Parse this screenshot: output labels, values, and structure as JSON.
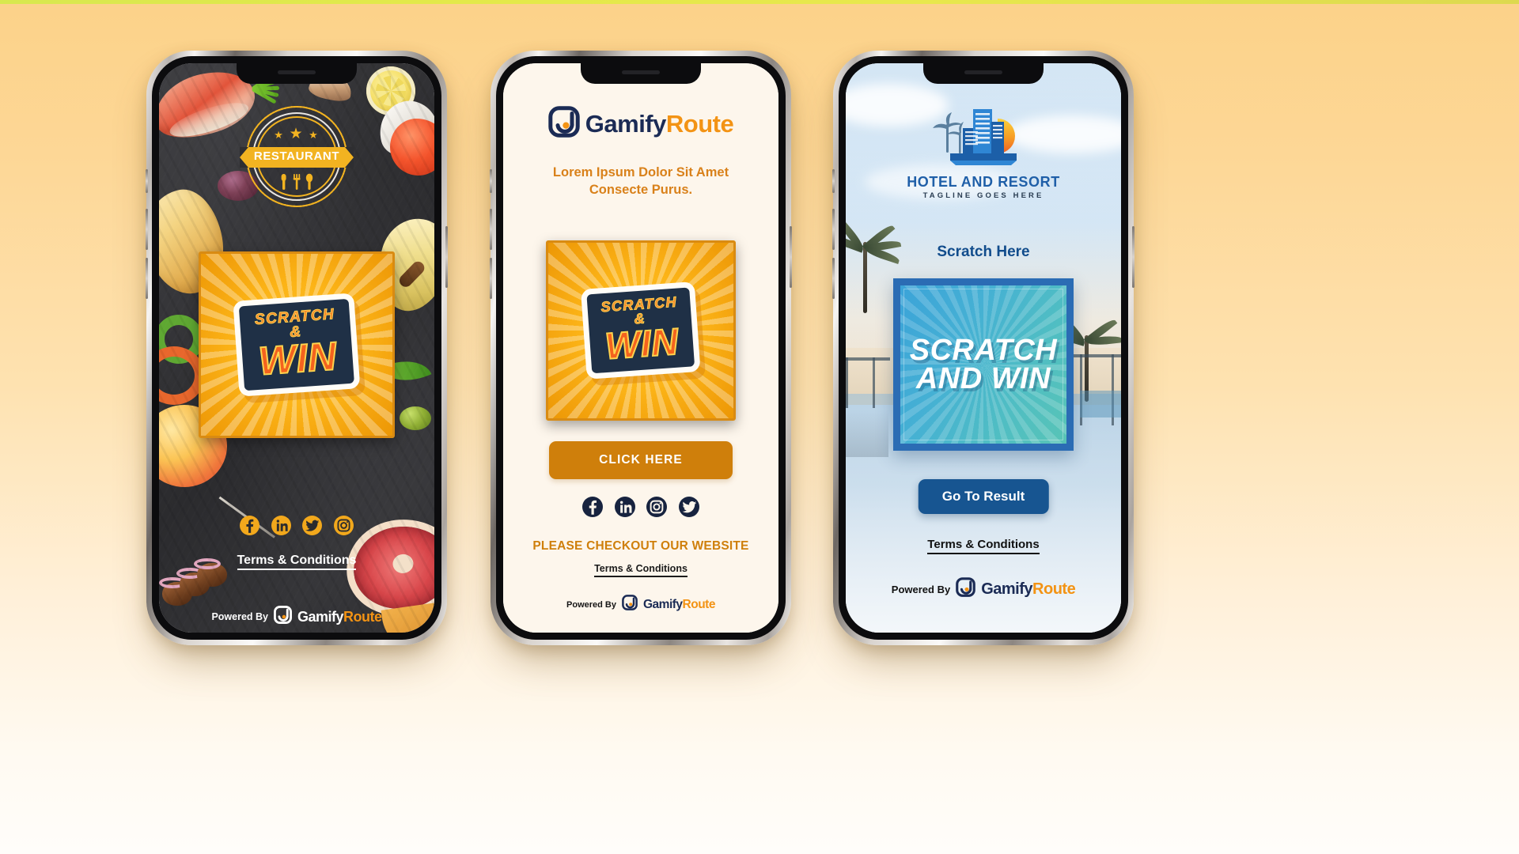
{
  "brand": {
    "name_primary": "Gamify",
    "name_secondary": "Route",
    "powered_by": "Powered By",
    "colors": {
      "navy": "#1b2b55",
      "orange": "#f39314",
      "amber": "#cf7f0b",
      "blue": "#175591"
    }
  },
  "phone1": {
    "theme": "restaurant",
    "badge": {
      "label": "RESTAURANT",
      "stars": "★ ★ ★",
      "cutlery_icons": "🍴"
    },
    "scratch_card": {
      "line1": "SCRATCH &",
      "line2": "WIN"
    },
    "social": [
      {
        "name": "facebook",
        "label": "Facebook"
      },
      {
        "name": "linkedin",
        "label": "LinkedIn"
      },
      {
        "name": "twitter",
        "label": "Twitter"
      },
      {
        "name": "instagram",
        "label": "Instagram"
      }
    ],
    "terms": "Terms & Conditions",
    "powered_by": "Powered By",
    "brand_primary": "Gamify",
    "brand_secondary": "Route"
  },
  "phone2": {
    "theme": "plain-white",
    "logo_primary": "Gamify",
    "logo_secondary": "Route",
    "headline": "Lorem Ipsum Dolor Sit Amet Consecte Purus.",
    "scratch_card": {
      "line1": "SCRATCH &",
      "line2": "WIN"
    },
    "cta_label": "CLICK HERE",
    "social": [
      {
        "name": "facebook",
        "label": "Facebook"
      },
      {
        "name": "linkedin",
        "label": "LinkedIn"
      },
      {
        "name": "instagram",
        "label": "Instagram"
      },
      {
        "name": "twitter",
        "label": "Twitter"
      }
    ],
    "website_text": "PLEASE CHECKOUT OUR WEBSITE",
    "terms": "Terms & Conditions",
    "powered_by": "Powered By",
    "brand_primary": "Gamify",
    "brand_secondary": "Route"
  },
  "phone3": {
    "theme": "hotel-resort",
    "logo": {
      "name": "HOTEL AND RESORT",
      "tagline": "TAGLINE GOES HERE"
    },
    "scratch_label": "Scratch Here",
    "scratch_card": {
      "line1": "SCRATCH",
      "line2": "AND WIN"
    },
    "cta_label": "Go To Result",
    "terms": "Terms & Conditions",
    "powered_by": "Powered By",
    "brand_primary": "Gamify",
    "brand_secondary": "Route"
  }
}
